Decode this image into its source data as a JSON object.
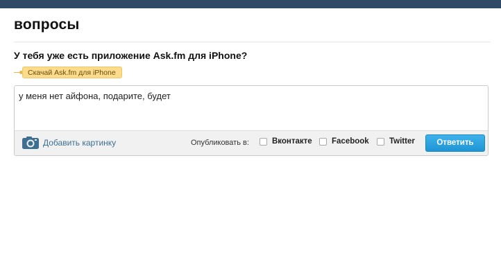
{
  "page": {
    "title": "вопросы"
  },
  "question": {
    "text": "У тебя уже есть приложение Ask.fm для iPhone?",
    "promo_tag": "Скачай Ask.fm для iPhone"
  },
  "answer": {
    "value": "у меня нет айфона, подарите, будет",
    "placeholder": ""
  },
  "toolbar": {
    "add_image_label": "Добавить картинку",
    "publish_label": "Опубликовать в:",
    "share_options": [
      {
        "label": "Вконтакте",
        "checked": false
      },
      {
        "label": "Facebook",
        "checked": false
      },
      {
        "label": "Twitter",
        "checked": false
      }
    ],
    "reply_label": "Ответить"
  },
  "icons": {
    "add_image": "camera-icon"
  },
  "colors": {
    "top_bar": "#2f4a64",
    "reply_button": "#2aa3e0",
    "promo_tag": "#fbdc8a",
    "link": "#3d6f93"
  }
}
